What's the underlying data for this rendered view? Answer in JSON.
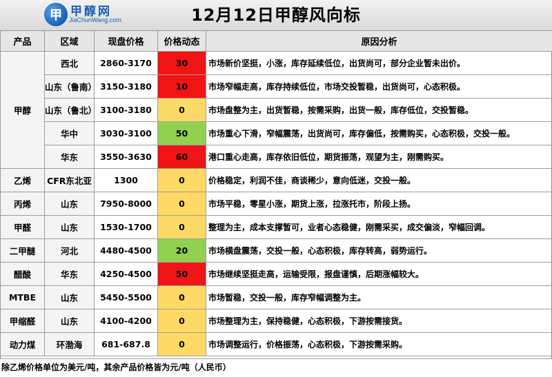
{
  "header": {
    "logo_mark": "甲",
    "logo_text": "甲醇网",
    "logo_sub": "JiaChunWang.com",
    "title": "12月12日甲醇风向标"
  },
  "columns": [
    "产品",
    "区域",
    "现盘价格",
    "价格动态",
    "原因分析"
  ],
  "rows": [
    {
      "product": "甲醇",
      "region": "西北",
      "price": "2860-3170",
      "change": "30",
      "color": "#f01414",
      "analysis": "市场新价坚挺，小涨，库存延续低位，出货尚可，部分企业暂未出价。"
    },
    {
      "product": "",
      "region": "山东（鲁南）",
      "price": "3150-3180",
      "change": "10",
      "color": "#f01414",
      "analysis": "市场窄幅走高，库存持续低位，市场交投暂稳，出货尚可，心态积极。"
    },
    {
      "product": "",
      "region": "山东（鲁北）",
      "price": "3100-3180",
      "change": "0",
      "color": "#ffd966",
      "analysis": "市场盘整为主，出货暂稳，按需采购，出货一般，库存低位，交投暂稳。"
    },
    {
      "product": "",
      "region": "华中",
      "price": "3030-3100",
      "change": "50",
      "color": "#92d050",
      "analysis": "市场重心下滑，窄幅震荡，出货尚可，库存偏低，按需购买，心态积极，交投一般。"
    },
    {
      "product": "",
      "region": "华东",
      "price": "3550-3630",
      "change": "60",
      "color": "#f01414",
      "analysis": "港口重心走高，库存依旧低位，期货振荡，观望为主，刚需购买。"
    },
    {
      "product": "乙烯",
      "region": "CFR东北亚",
      "price": "1300",
      "change": "0",
      "color": "#ffd966",
      "analysis": "价格稳定，利润不佳，商谈稀少，意向低迷，交投一般。"
    },
    {
      "product": "丙烯",
      "region": "山东",
      "price": "7950-8000",
      "change": "0",
      "color": "#ffd966",
      "analysis": "市场平稳，零星小涨，期货上涨，拉涨托市，阶段上扬。"
    },
    {
      "product": "甲醛",
      "region": "山东",
      "price": "1530-1700",
      "change": "0",
      "color": "#ffd966",
      "analysis": "整理为主，成本支撑暂可，业者心态稳健，刚需采买，成交偏淡，窄幅回调。"
    },
    {
      "product": "二甲醚",
      "region": "河北",
      "price": "4480-4500",
      "change": "20",
      "color": "#92d050",
      "analysis": "市场横盘震荡，交投一般，心态积极，库存转高，弱势运行。"
    },
    {
      "product": "醋酸",
      "region": "华东",
      "price": "4250-4500",
      "change": "50",
      "color": "#f01414",
      "analysis": "市场继续坚挺走高，运输受限，报盘谨慎，后期涨幅较大。"
    },
    {
      "product": "MTBE",
      "region": "山东",
      "price": "5450-5500",
      "change": "0",
      "color": "#ffd966",
      "analysis": "市场暂稳，交投一般，库存窄幅调整为主。"
    },
    {
      "product": "甲缩醛",
      "region": "山东",
      "price": "4100-4200",
      "change": "0",
      "color": "#ffd966",
      "analysis": "市场整理为主，保持稳健，心态积极，下游按需接货。"
    },
    {
      "product": "动力煤",
      "region": "环渤海",
      "price": "681-687.8",
      "change": "0",
      "color": "#ffd966",
      "analysis": "市场调整运行，价格振荡，心态积极，下游按需采购。"
    }
  ],
  "footer": "除乙烯价格单位为美元/吨，其余产品价格皆为元/吨（人民币）"
}
